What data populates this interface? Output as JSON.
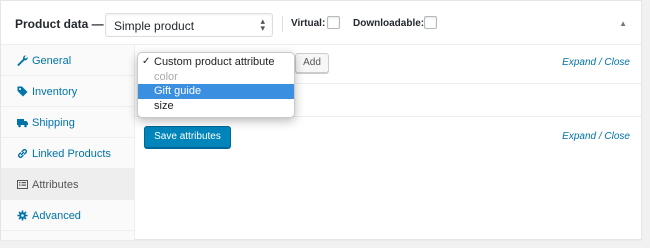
{
  "header": {
    "title": "Product data —",
    "product_type": "Simple product",
    "virtual_label": "Virtual:",
    "downloadable_label": "Downloadable:"
  },
  "tabs": [
    {
      "label": "General",
      "icon": "wrench-icon",
      "active": false
    },
    {
      "label": "Inventory",
      "icon": "tag-icon",
      "active": false
    },
    {
      "label": "Shipping",
      "icon": "truck-icon",
      "active": false
    },
    {
      "label": "Linked Products",
      "icon": "link-icon",
      "active": false
    },
    {
      "label": "Attributes",
      "icon": "list-icon",
      "active": true
    },
    {
      "label": "Advanced",
      "icon": "gear-icon",
      "active": false
    }
  ],
  "attribute_dropdown": {
    "options": [
      {
        "label": "Custom product attribute",
        "checked": true,
        "disabled": false,
        "highlighted": false
      },
      {
        "label": "color",
        "checked": false,
        "disabled": true,
        "highlighted": false
      },
      {
        "label": "Gift guide",
        "checked": false,
        "disabled": false,
        "highlighted": true
      },
      {
        "label": "size",
        "checked": false,
        "disabled": false,
        "highlighted": false
      }
    ]
  },
  "toolbar": {
    "add_label": "Add",
    "expand_close_top": "Expand / Close",
    "save_label": "Save attributes",
    "expand_close_bottom": "Expand / Close"
  },
  "colors": {
    "accent": "#0073aa",
    "primary_button": "#0085ba",
    "highlight": "#3b8fe0"
  }
}
